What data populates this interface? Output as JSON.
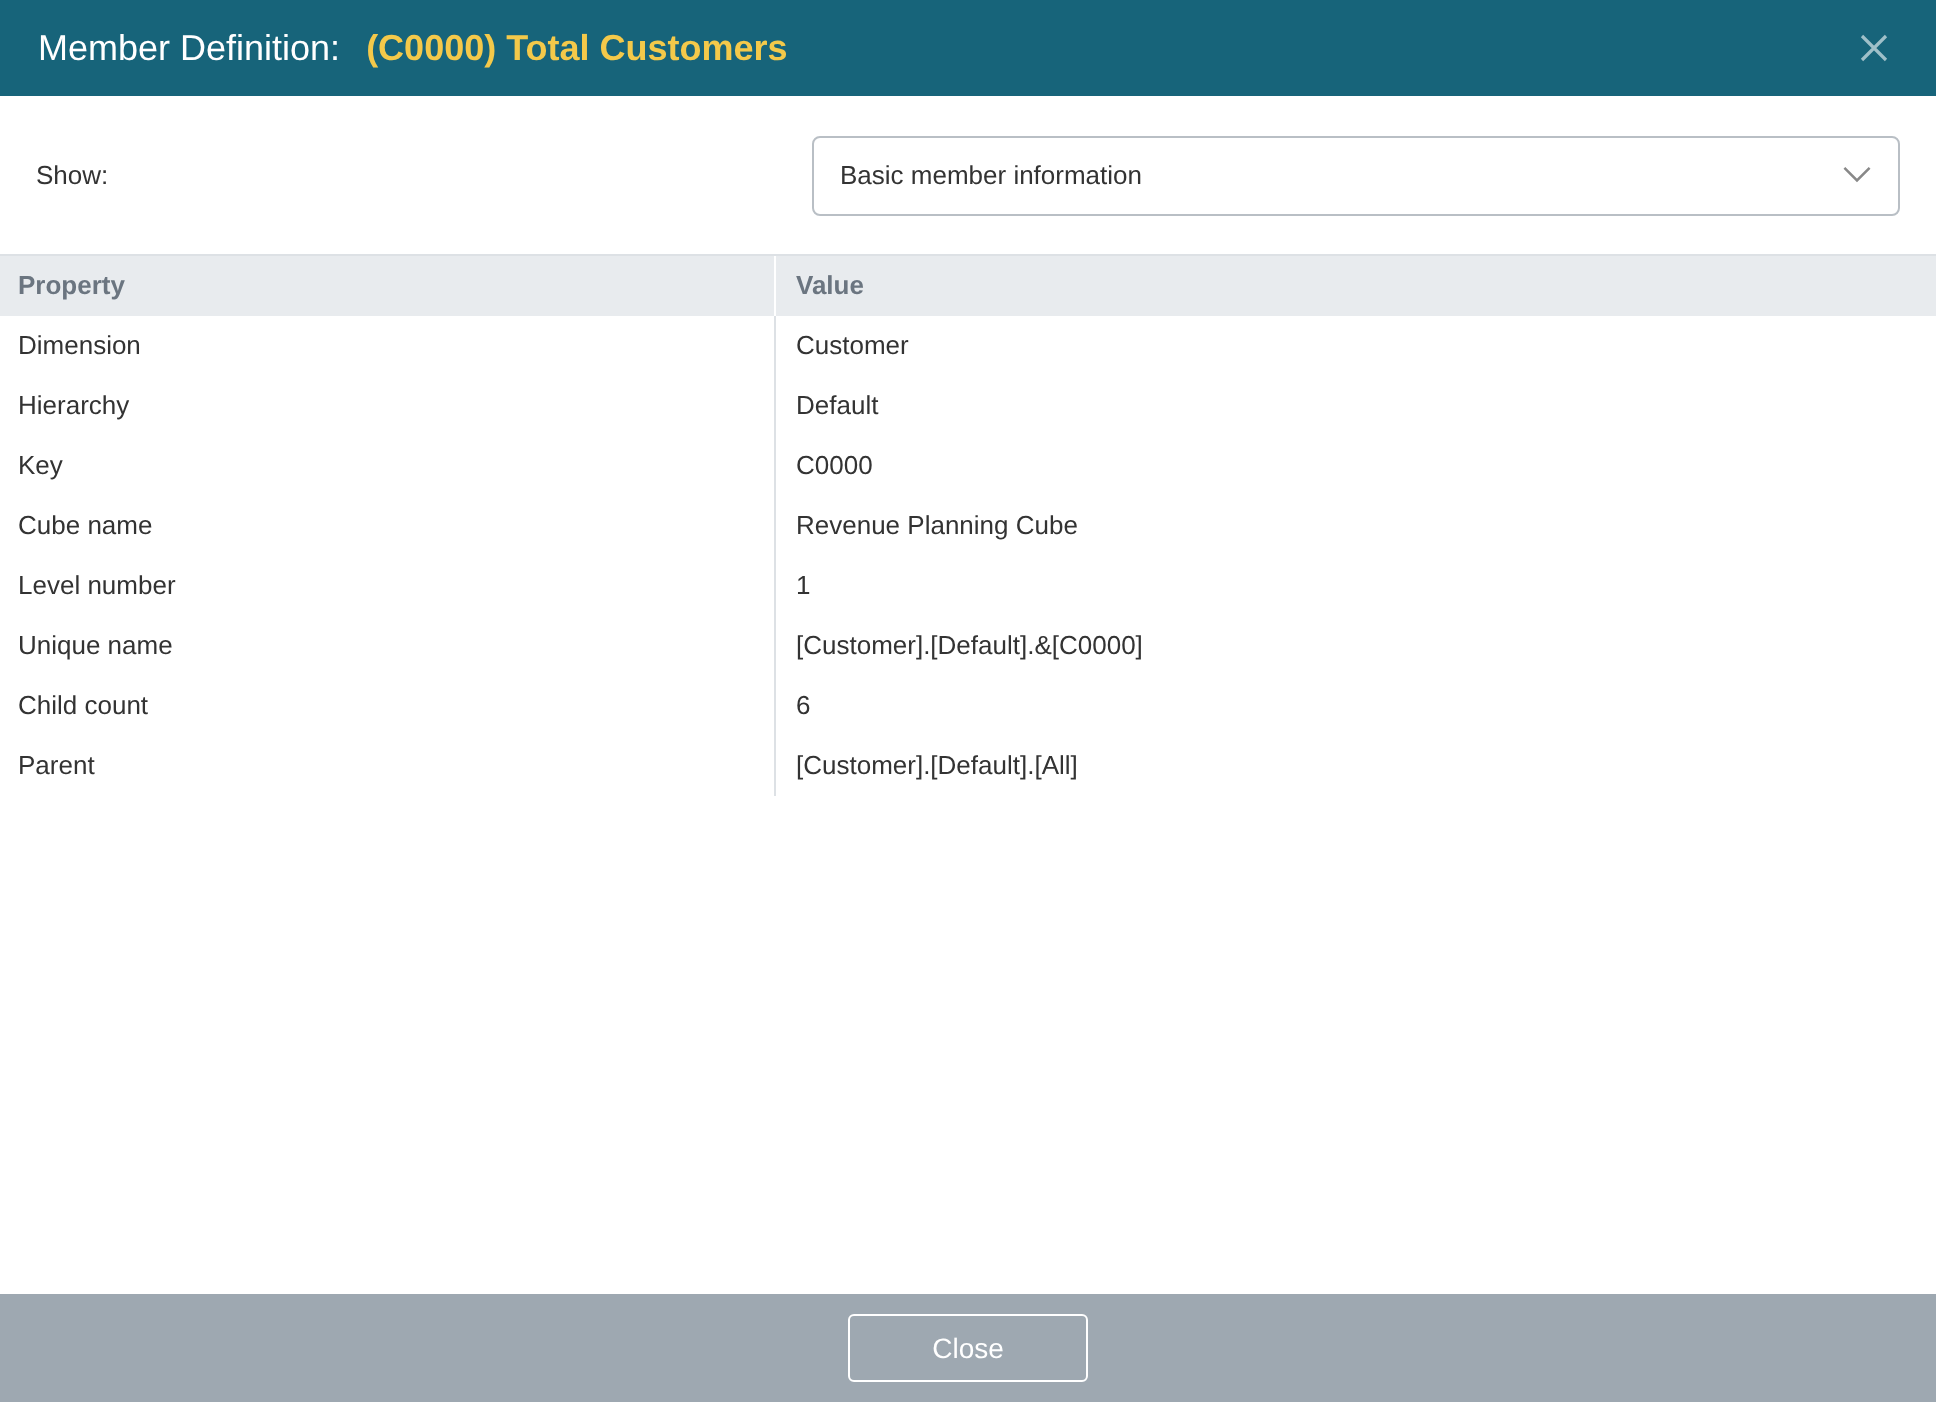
{
  "dialog": {
    "title": "Member Definition:",
    "member": "(C0000) Total Customers"
  },
  "show": {
    "label": "Show:",
    "value": "Basic member information"
  },
  "table": {
    "columns": [
      "Property",
      "Value"
    ],
    "rows": [
      [
        "Dimension",
        "Customer"
      ],
      [
        "Hierarchy",
        "Default"
      ],
      [
        "Key",
        "C0000"
      ],
      [
        "Cube name",
        "Revenue Planning Cube"
      ],
      [
        "Level number",
        "1"
      ],
      [
        "Unique name",
        "[Customer].[Default].&[C0000]"
      ],
      [
        "Child count",
        "6"
      ],
      [
        "Parent",
        "[Customer].[Default].[All]"
      ]
    ]
  },
  "buttons": [
    "Close"
  ]
}
